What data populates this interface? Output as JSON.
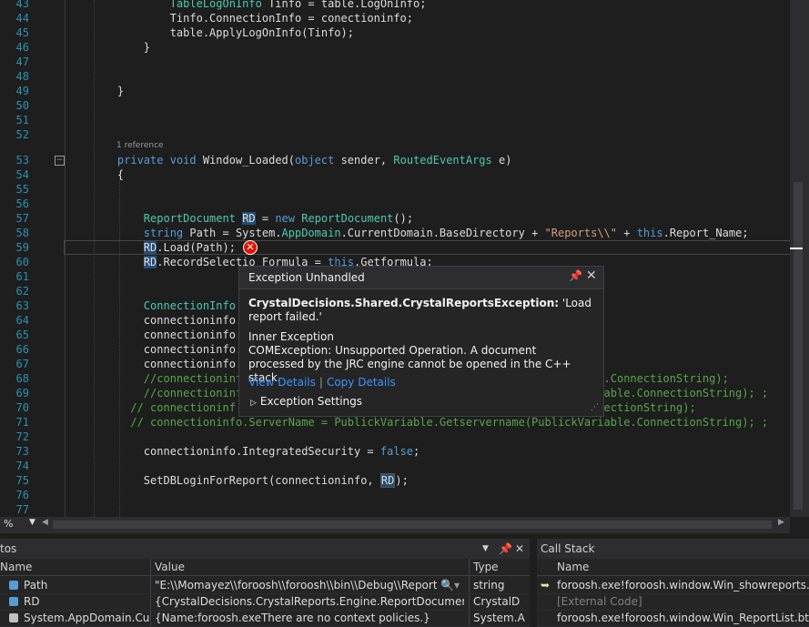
{
  "editor": {
    "reference_hint": "1 reference",
    "lines": [
      {
        "n": "43",
        "html": "            <span class='ty'>TableLogOnInfo</span> Tinfo = table.LogOnInfo;"
      },
      {
        "n": "44",
        "html": "            Tinfo.ConnectionInfo = conectioninfo;"
      },
      {
        "n": "45",
        "html": "            table.ApplyLogOnInfo(Tinfo);"
      },
      {
        "n": "46",
        "html": "        }"
      },
      {
        "n": "47",
        "html": ""
      },
      {
        "n": "48",
        "html": ""
      },
      {
        "n": "49",
        "html": "    }"
      },
      {
        "n": "50",
        "html": ""
      },
      {
        "n": "51",
        "html": ""
      },
      {
        "n": "52",
        "html": ""
      },
      {
        "n": "53",
        "html": "    <span class='kw'>private</span> <span class='kw'>void</span> Window_Loaded(<span class='kw'>object</span> sender, <span class='ty'>RoutedEventArgs</span> e)"
      },
      {
        "n": "54",
        "html": "    {"
      },
      {
        "n": "55",
        "html": ""
      },
      {
        "n": "56",
        "html": ""
      },
      {
        "n": "57",
        "html": "        <span class='ty'>ReportDocument</span> <span class='hl'>RD</span> = <span class='kw'>new</span> <span class='ty'>ReportDocument</span>();"
      },
      {
        "n": "58",
        "html": "        <span class='kw'>string</span> Path = System.<span class='ty'>AppDomain</span>.CurrentDomain.BaseDirectory + <span class='str'>\"Reports\\\\\"</span> + <span class='kw'>this</span>.Report_Name;"
      },
      {
        "n": "59",
        "html": "        <span class='hl'>RD</span>.Load(Path);"
      },
      {
        "n": "60",
        "html": "        <span class='hl'>RD</span>.RecordSelectio Formula = <span class='kw'>this</span>.Getformula;"
      },
      {
        "n": "61",
        "html": ""
      },
      {
        "n": "62",
        "html": ""
      },
      {
        "n": "63",
        "html": "        <span class='ty'>ConnectionInfo</span>"
      },
      {
        "n": "64",
        "html": "        connectioninfo.C"
      },
      {
        "n": "65",
        "html": "        connectioninfo.U"
      },
      {
        "n": "66",
        "html": "        connectioninfo.I"
      },
      {
        "n": "67",
        "html": "        connectioninfo.S"
      },
      {
        "n": "68",
        "html": "        <span class='cm'>//connectioninf                                                    ble.ConnectionString);</span>"
      },
      {
        "n": "69",
        "html": "        <span class='cm'>//connectioninf                                                    ariable.ConnectionString); ;</span>"
      },
      {
        "n": "70",
        "html": "      <span class='cm'>// connectioninf                                                    ConnectionString);</span>"
      },
      {
        "n": "71",
        "html": "      <span class='cm'>// connectioninfo.ServerName = PublickVariable.Getservername(PublickVariable.ConnectionString); ;</span>"
      },
      {
        "n": "72",
        "html": ""
      },
      {
        "n": "73",
        "html": "        connectioninfo.IntegratedSecurity = <span class='kw'>false</span>;"
      },
      {
        "n": "74",
        "html": ""
      },
      {
        "n": "75",
        "html": "        SetDBLoginForReport(connectioninfo, <span class='hl hlbox'>RD</span>);"
      },
      {
        "n": "76",
        "html": ""
      },
      {
        "n": "77",
        "html": ""
      }
    ]
  },
  "statusbar": {
    "zoom": "%"
  },
  "exception_popup": {
    "title": "Exception Unhandled",
    "pin_icon": "pin-icon",
    "close_icon": "close-icon",
    "exception_type": "CrystalDecisions.Shared.CrystalReportsException:",
    "message": "'Load report failed.'",
    "inner_heading": "Inner Exception",
    "inner_message": "COMException: Unsupported Operation. A document processed by the JRC engine cannot be opened in the C++ stack.",
    "view_details": "View Details",
    "copy_details": "Copy Details",
    "settings": "Exception Settings",
    "accent": "#3794ff"
  },
  "autos": {
    "title": "tos",
    "columns": {
      "name": "Name",
      "value": "Value",
      "type": "Type"
    },
    "rows": [
      {
        "name": "Path",
        "value": "\"E:\\\\Momayez\\\\foroosh\\\\foroosh\\\\bin\\\\Debug\\\\Reports\\\\\"",
        "type": "string"
      },
      {
        "name": "RD",
        "value": "{CrystalDecisions.CrystalReports.Engine.ReportDocument}",
        "type": "CrystalD"
      },
      {
        "name": "System.AppDomain.Curre",
        "value": "{Name:foroosh.exeThere are no context policies.}",
        "type": "System.A"
      }
    ]
  },
  "callstack": {
    "title": "Call Stack",
    "columns": {
      "name": "Name"
    },
    "rows": [
      {
        "name": "foroosh.exe!foroosh.window.Win_showreports.Window_Lo"
      },
      {
        "name": "[External Code]"
      },
      {
        "name": "foroosh.exe!foroosh.window.Win_ReportList.btn_show_C"
      }
    ]
  },
  "colors": {
    "background": "#1e1e1e",
    "keyword": "#569cd6",
    "type": "#4ec9b0",
    "string": "#d69d85",
    "comment": "#57a64a",
    "error": "#e51400"
  }
}
